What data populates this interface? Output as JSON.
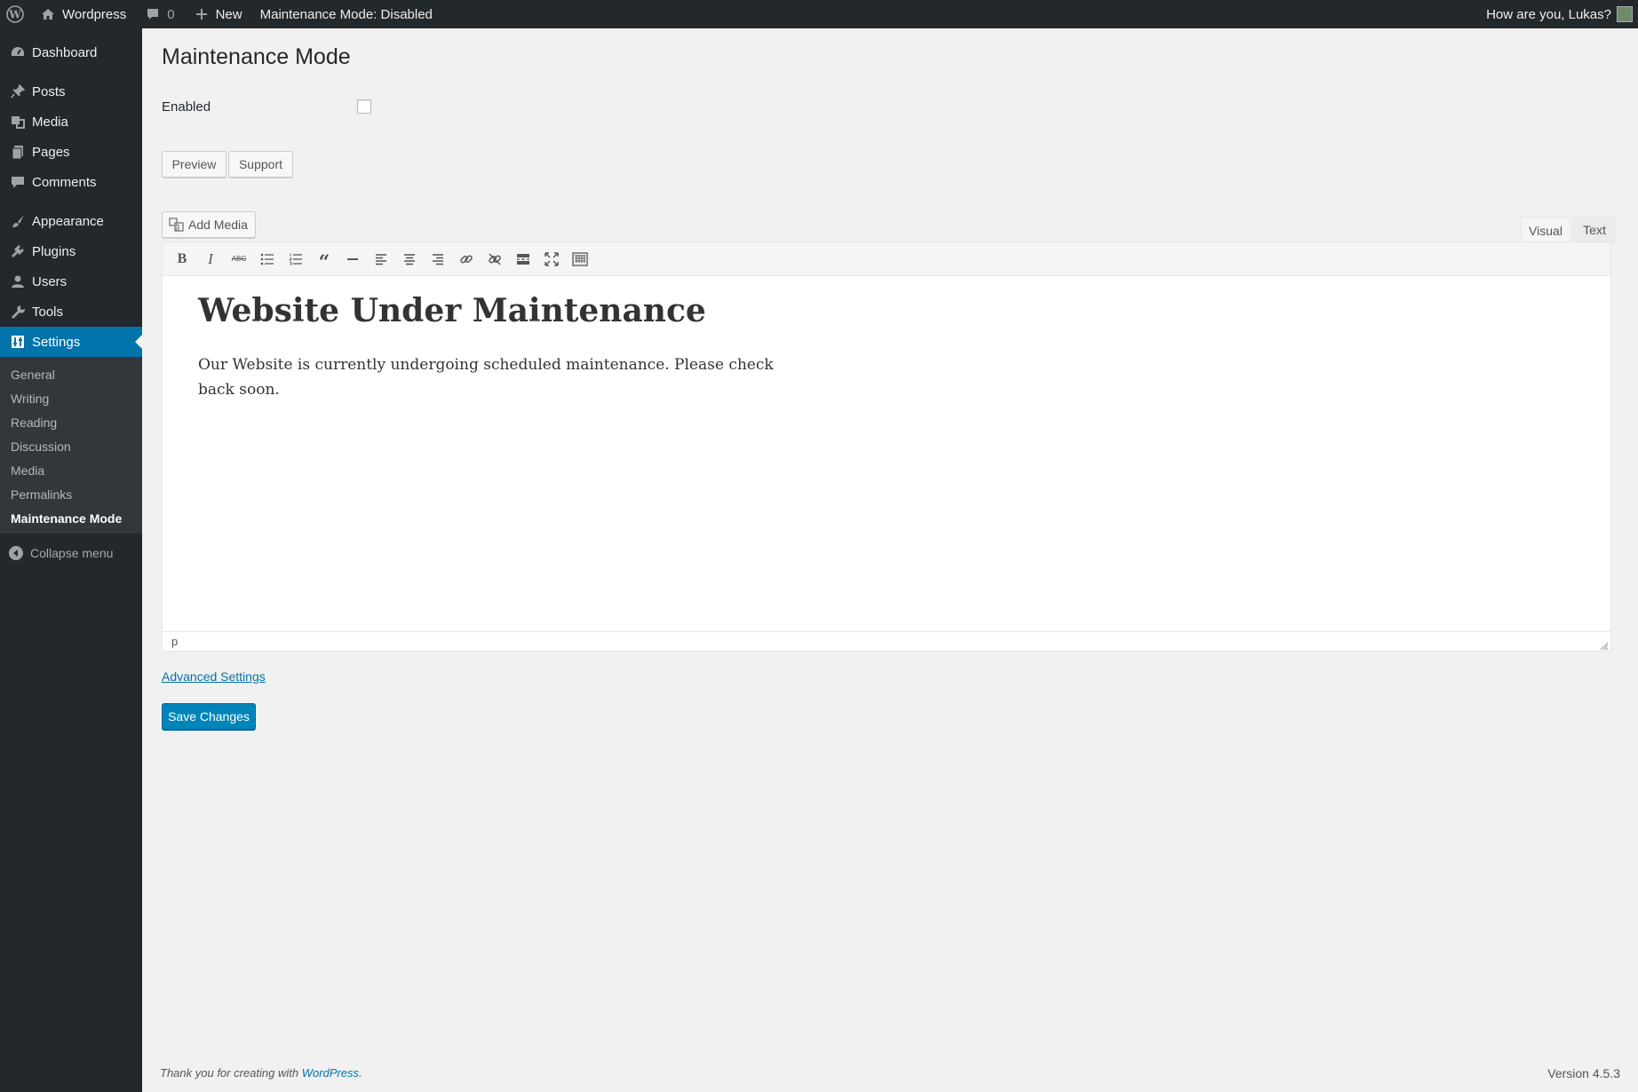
{
  "adminbar": {
    "site_name": "Wordpress",
    "comments_count": "0",
    "new_label": "New",
    "maintenance_status": "Maintenance Mode: Disabled",
    "greeting": "How are you, Lukas?"
  },
  "sidebar": {
    "items": [
      {
        "label": "Dashboard",
        "icon": "dashboard-icon"
      },
      {
        "label": "Posts",
        "icon": "pushpin-icon"
      },
      {
        "label": "Media",
        "icon": "media-icon"
      },
      {
        "label": "Pages",
        "icon": "pages-icon"
      },
      {
        "label": "Comments",
        "icon": "comment-icon"
      },
      {
        "label": "Appearance",
        "icon": "brush-icon"
      },
      {
        "label": "Plugins",
        "icon": "plugin-icon"
      },
      {
        "label": "Users",
        "icon": "user-icon"
      },
      {
        "label": "Tools",
        "icon": "wrench-icon"
      },
      {
        "label": "Settings",
        "icon": "settings-icon"
      }
    ],
    "submenu": [
      "General",
      "Writing",
      "Reading",
      "Discussion",
      "Media",
      "Permalinks",
      "Maintenance Mode"
    ],
    "collapse_label": "Collapse menu"
  },
  "main": {
    "title": "Maintenance Mode",
    "enabled_label": "Enabled",
    "enabled_checked": false,
    "preview_label": "Preview",
    "support_label": "Support",
    "add_media_label": "Add Media",
    "tab_visual": "Visual",
    "tab_text": "Text",
    "editor": {
      "heading": "Website Under Maintenance",
      "paragraph": "Our Website is currently undergoing scheduled maintenance. Please check back soon.",
      "status_path": "p"
    },
    "advanced_link": "Advanced Settings",
    "save_label": "Save Changes"
  },
  "footer": {
    "thanks": "Thank you for creating with",
    "wp_link": "WordPress",
    "version": "Version 4.5.3"
  },
  "colors": {
    "adminbar_bg": "#23282d",
    "accent": "#0073aa",
    "primary_button": "#0085ba",
    "page_bg": "#f1f1f1"
  }
}
